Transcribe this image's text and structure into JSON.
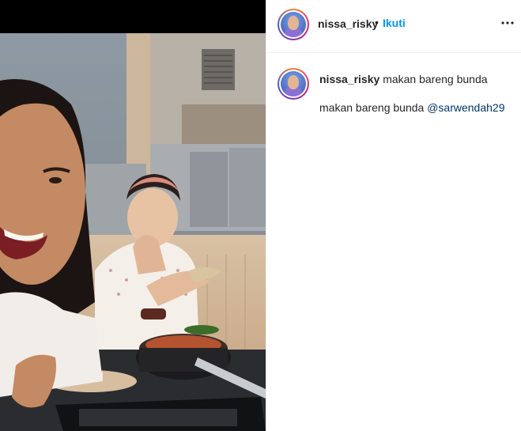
{
  "post": {
    "media_alt": "photo of two women eating at a restaurant",
    "author": {
      "username": "nissa_risky",
      "separator": "•",
      "follow_label": "Ikuti"
    },
    "caption": {
      "username": "nissa_risky",
      "text": "makan bareng bunda",
      "body": "makan bareng bunda",
      "mention": "@sarwendah29"
    },
    "icons": {
      "more": "more-horizontal-icon",
      "avatar": "profile-avatar"
    },
    "colors": {
      "link_blue": "#0095f6",
      "mention_blue": "#00376b",
      "divider": "#efefef"
    }
  }
}
